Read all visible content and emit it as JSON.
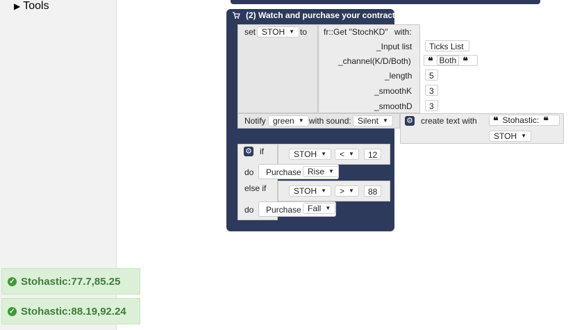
{
  "toolbox": {
    "tools_label": "Tools"
  },
  "block": {
    "header": "(2) Watch and purchase your contract",
    "set_label": "set",
    "var_name": "STOH",
    "to_label": "to",
    "fn_call": "fr::Get \"StochKD\"",
    "with_label": "with:",
    "inputs": [
      {
        "label": "_Input list",
        "value": "Ticks List"
      },
      {
        "label": "_channel(K/D/Both)",
        "value": "Both"
      },
      {
        "label": "_length",
        "value": "5"
      },
      {
        "label": "_smoothK",
        "value": "3"
      },
      {
        "label": "_smoothD",
        "value": "3"
      }
    ],
    "notify": {
      "label": "Notify",
      "color": "green",
      "sound_label": "with sound:",
      "sound": "Silent",
      "create_label": "create text with",
      "text": "Stohastic:",
      "var": "STOH"
    },
    "if1": {
      "if_label": "if",
      "var": "STOH",
      "op": "<",
      "value": "12",
      "do_label": "do",
      "action": "Purchase",
      "type": "Rise"
    },
    "if2": {
      "label": "else if",
      "var": "STOH",
      "op": ">",
      "value": "88",
      "do_label": "do",
      "action": "Purchase",
      "type": "Fall"
    }
  },
  "notifications": [
    "Stohastic:77.7,85.25",
    "Stohastic:88.19,92.24"
  ],
  "colors": {
    "block": "#2d3a5c",
    "notification_bg": "#dcefd7",
    "notification_text": "#3f7d3b"
  }
}
